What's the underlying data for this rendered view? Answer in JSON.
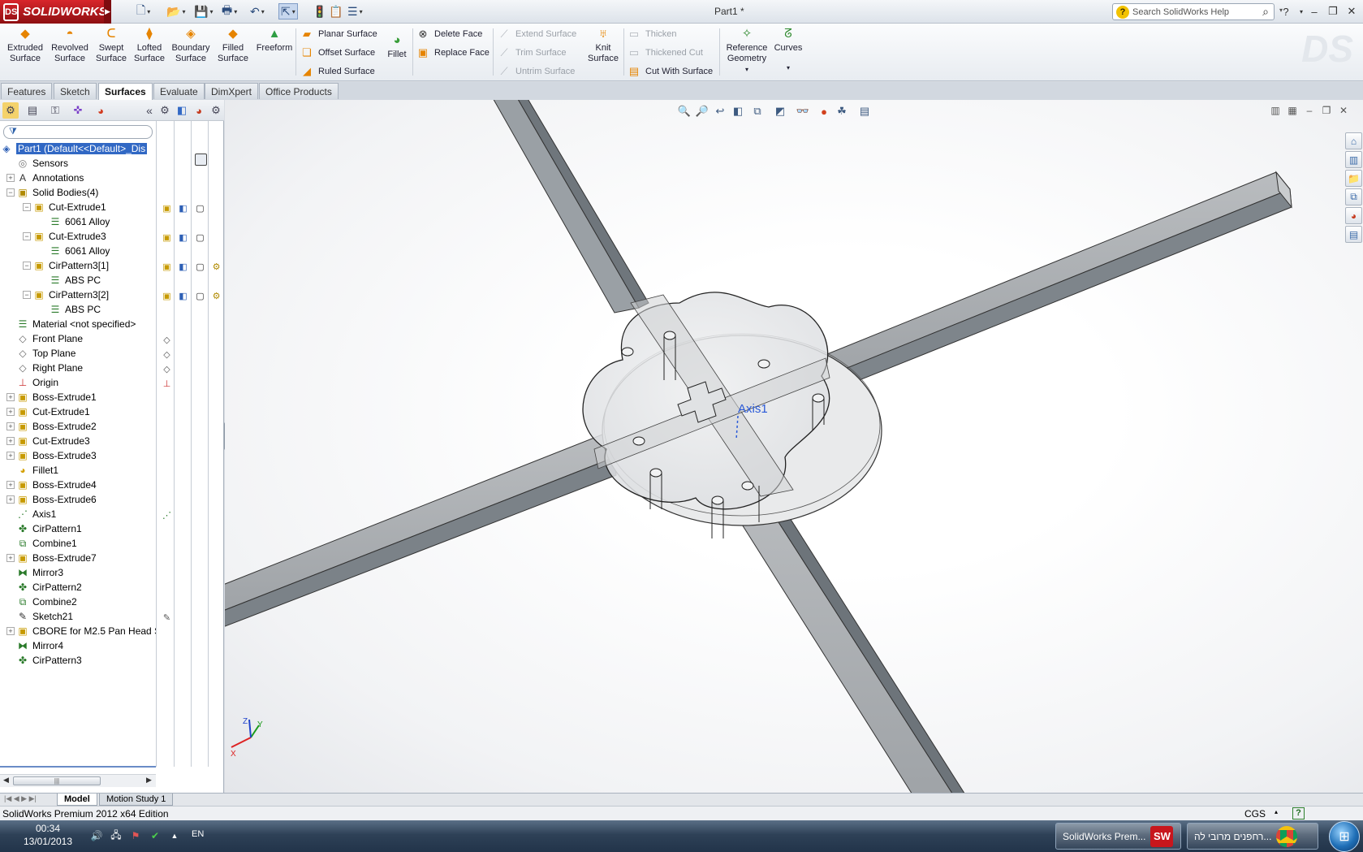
{
  "app": {
    "brand": "SOLIDWORKS",
    "brand_mark": "DS",
    "document_title": "Part1 *",
    "search_placeholder": "Search SolidWorks Help",
    "search_icon_glyph": "?"
  },
  "surface_tools": {
    "extruded": "Extruded\nSurface",
    "revolved": "Revolved\nSurface",
    "swept": "Swept\nSurface",
    "lofted": "Lofted\nSurface",
    "boundary": "Boundary\nSurface",
    "filled": "Filled\nSurface",
    "freeform": "Freeform",
    "planar": "Planar Surface",
    "offset": "Offset Surface",
    "ruled": "Ruled Surface",
    "fillet": "Fillet",
    "delete_face": "Delete Face",
    "replace_face": "Replace Face",
    "extend": "Extend Surface",
    "trim": "Trim Surface",
    "untrim": "Untrim Surface",
    "knit": "Knit\nSurface",
    "thicken": "Thicken",
    "thickened_cut": "Thickened Cut",
    "cut_with_surface": "Cut With Surface",
    "reference_geometry": "Reference\nGeometry",
    "curves": "Curves"
  },
  "tabs": [
    "Features",
    "Sketch",
    "Surfaces",
    "Evaluate",
    "DimXpert",
    "Office Products"
  ],
  "active_tab": "Surfaces",
  "feature_tree": {
    "root": "Part1  (Default<<Default>_Dis",
    "items": [
      {
        "label": "Sensors",
        "icon": "sensor-icon",
        "level": 0,
        "expand": ""
      },
      {
        "label": "Annotations",
        "icon": "annotation-icon",
        "level": 0,
        "expand": "+"
      },
      {
        "label": "Solid Bodies(4)",
        "icon": "solid-bodies-icon",
        "level": 0,
        "expand": "−"
      },
      {
        "label": "Cut-Extrude1",
        "icon": "body-icon",
        "level": 1,
        "expand": "−"
      },
      {
        "label": "6061 Alloy",
        "icon": "material-icon",
        "level": 2,
        "expand": ""
      },
      {
        "label": "Cut-Extrude3",
        "icon": "body-icon",
        "level": 1,
        "expand": "−"
      },
      {
        "label": "6061 Alloy",
        "icon": "material-icon",
        "level": 2,
        "expand": ""
      },
      {
        "label": "CirPattern3[1]",
        "icon": "body-icon",
        "level": 1,
        "expand": "−"
      },
      {
        "label": "ABS PC",
        "icon": "material-icon",
        "level": 2,
        "expand": ""
      },
      {
        "label": "CirPattern3[2]",
        "icon": "body-icon",
        "level": 1,
        "expand": "−"
      },
      {
        "label": "ABS PC",
        "icon": "material-icon",
        "level": 2,
        "expand": ""
      },
      {
        "label": "Material <not specified>",
        "icon": "material-icon",
        "level": 0,
        "expand": ""
      },
      {
        "label": "Front Plane",
        "icon": "plane-icon",
        "level": 0,
        "expand": ""
      },
      {
        "label": "Top Plane",
        "icon": "plane-icon",
        "level": 0,
        "expand": ""
      },
      {
        "label": "Right Plane",
        "icon": "plane-icon",
        "level": 0,
        "expand": ""
      },
      {
        "label": "Origin",
        "icon": "origin-icon",
        "level": 0,
        "expand": ""
      },
      {
        "label": "Boss-Extrude1",
        "icon": "extrude-icon",
        "level": 0,
        "expand": "+"
      },
      {
        "label": "Cut-Extrude1",
        "icon": "cut-icon",
        "level": 0,
        "expand": "+"
      },
      {
        "label": "Boss-Extrude2",
        "icon": "extrude-icon",
        "level": 0,
        "expand": "+"
      },
      {
        "label": "Cut-Extrude3",
        "icon": "cut-icon",
        "level": 0,
        "expand": "+"
      },
      {
        "label": "Boss-Extrude3",
        "icon": "extrude-icon",
        "level": 0,
        "expand": "+"
      },
      {
        "label": "Fillet1",
        "icon": "fillet-icon",
        "level": 0,
        "expand": ""
      },
      {
        "label": "Boss-Extrude4",
        "icon": "extrude-icon",
        "level": 0,
        "expand": "+"
      },
      {
        "label": "Boss-Extrude6",
        "icon": "extrude-icon",
        "level": 0,
        "expand": "+"
      },
      {
        "label": "Axis1",
        "icon": "axis-icon",
        "level": 0,
        "expand": ""
      },
      {
        "label": "CirPattern1",
        "icon": "pattern-icon",
        "level": 0,
        "expand": ""
      },
      {
        "label": "Combine1",
        "icon": "combine-icon",
        "level": 0,
        "expand": ""
      },
      {
        "label": "Boss-Extrude7",
        "icon": "extrude-icon",
        "level": 0,
        "expand": "+"
      },
      {
        "label": "Mirror3",
        "icon": "mirror-icon",
        "level": 0,
        "expand": ""
      },
      {
        "label": "CirPattern2",
        "icon": "pattern-icon",
        "level": 0,
        "expand": ""
      },
      {
        "label": "Combine2",
        "icon": "combine-icon",
        "level": 0,
        "expand": ""
      },
      {
        "label": "Sketch21",
        "icon": "sketch-icon",
        "level": 0,
        "expand": ""
      },
      {
        "label": "CBORE for M2.5 Pan Head S",
        "icon": "hole-icon",
        "level": 0,
        "expand": "+"
      },
      {
        "label": "Mirror4",
        "icon": "mirror-icon",
        "level": 0,
        "expand": ""
      },
      {
        "label": "CirPattern3",
        "icon": "pattern-icon",
        "level": 0,
        "expand": ""
      }
    ]
  },
  "viewport": {
    "axis_label": "Axis1",
    "triad": {
      "x": "X",
      "y": "Y",
      "z": "Z"
    }
  },
  "bottom_tabs": [
    "Model",
    "Motion Study 1"
  ],
  "status": {
    "edition": "SolidWorks Premium 2012 x64 Edition",
    "units": "CGS"
  },
  "taskbar": {
    "time": "00:34",
    "date": "13/01/2013",
    "lang": "EN",
    "apps": [
      {
        "label": "SolidWorks Prem...",
        "icon": "SW"
      },
      {
        "label": "רחפנים מרובי לה...",
        "icon": "chrome"
      }
    ]
  },
  "colors": {
    "brand_red": "#c8161d",
    "selection_blue": "#3168c4",
    "axis_blue": "#2a5ad8"
  }
}
